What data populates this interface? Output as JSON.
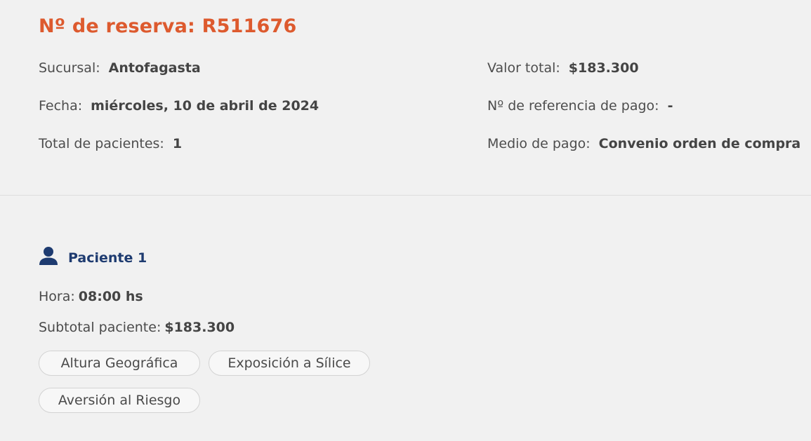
{
  "reservation": {
    "title": "Nº de reserva: R511676"
  },
  "details": {
    "branch_label": "Sucursal:",
    "branch_value": "Antofagasta",
    "date_label": "Fecha:",
    "date_value": "miércoles, 10 de abril de 2024",
    "patients_label": "Total de pacientes:",
    "patients_value": "1",
    "total_label": "Valor total:",
    "total_value": "$183.300",
    "payment_ref_label": "Nº de referencia de pago:",
    "payment_ref_value": "-",
    "payment_method_label": "Medio de pago:",
    "payment_method_value": "Convenio orden de compra"
  },
  "patient": {
    "icon": "person-icon",
    "name": "Paciente 1",
    "time_label": "Hora:",
    "time_value": "08:00 hs",
    "subtotal_label": "Subtotal paciente:",
    "subtotal_value": "$183.300",
    "exams": [
      "Altura Geográfica",
      "Exposición a Sílice",
      "Aversión al Riesgo"
    ]
  },
  "colors": {
    "accent": "#dd5a2e",
    "patient_name": "#1e3b70",
    "background": "#f1f1f1"
  }
}
